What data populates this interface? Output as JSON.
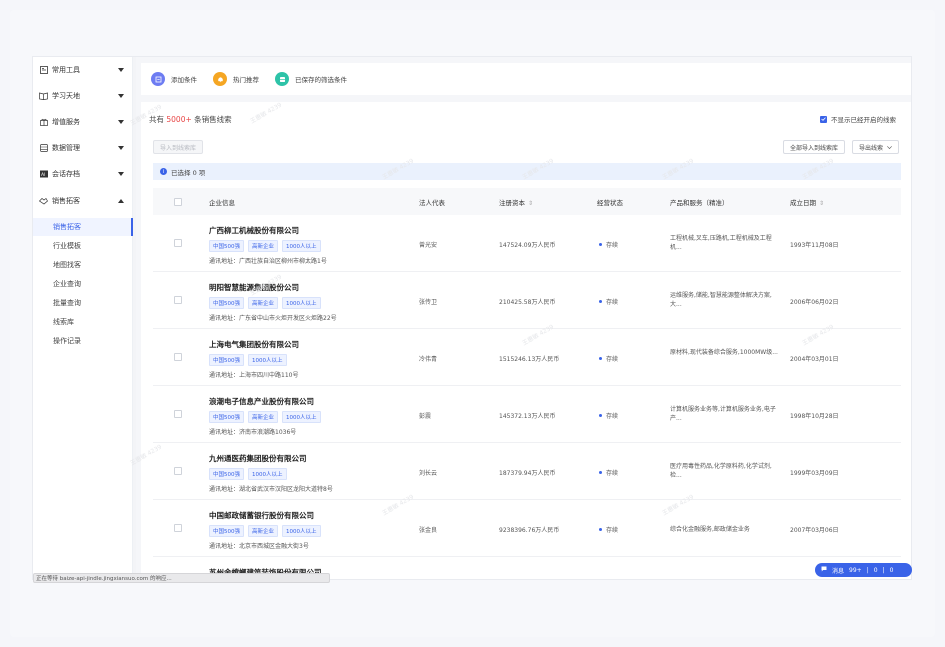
{
  "sidebar": {
    "groups": [
      {
        "label": "常用工具",
        "icon": "toolbox-icon",
        "expanded": false
      },
      {
        "label": "学习天地",
        "icon": "book-icon",
        "expanded": false
      },
      {
        "label": "增值服务",
        "icon": "gift-icon",
        "expanded": false
      },
      {
        "label": "数据管理",
        "icon": "database-icon",
        "expanded": false
      },
      {
        "label": "会话存档",
        "icon": "archive-icon",
        "expanded": false
      },
      {
        "label": "销售拓客",
        "icon": "handshake-icon",
        "expanded": true
      }
    ],
    "sub_items": [
      {
        "label": "销售拓客",
        "active": true
      },
      {
        "label": "行业模板",
        "active": false
      },
      {
        "label": "地图找客",
        "active": false
      },
      {
        "label": "企业查询",
        "active": false
      },
      {
        "label": "批量查询",
        "active": false
      },
      {
        "label": "线索库",
        "active": false
      },
      {
        "label": "操作记录",
        "active": false
      }
    ]
  },
  "toolbar": {
    "items": [
      {
        "label": "添加条件",
        "icon": "add-filter-icon",
        "color": "#6d7cf2"
      },
      {
        "label": "热门推荐",
        "icon": "bell-icon",
        "color": "#f5a623"
      },
      {
        "label": "已保存的筛选条件",
        "icon": "saved-icon",
        "color": "#2ec3a8"
      }
    ]
  },
  "summary": {
    "prefix": "共有",
    "count": "5000+",
    "suffix": "条销售线索",
    "hide_opened_label": "不显示已经开启的线索",
    "hide_opened_checked": true
  },
  "actions": {
    "import_to_library": "导入到线索库",
    "import_all": "全部导入到线索库",
    "export": "导出线索"
  },
  "selection": {
    "text": "已选择 0 项"
  },
  "table": {
    "headers": {
      "company": "企业信息",
      "legal_rep": "法人代表",
      "capital": "注册资本",
      "status": "经营状态",
      "products": "产品和服务（精准）",
      "founded": "成立日期"
    },
    "address_prefix": "通讯地址：",
    "rows": [
      {
        "company": "广西柳工机械股份有限公司",
        "tags": [
          "中国500强",
          "高新企业",
          "1000人以上"
        ],
        "address": "广西壮族自治区柳州市柳太路1号",
        "legal_rep": "曾光安",
        "capital": "147524.09万人民币",
        "status": "存续",
        "products": "工程机械,叉车,压路机,工程机械及工程机...",
        "founded": "1993年11月08日"
      },
      {
        "company": "明阳智慧能源集团股份公司",
        "tags": [
          "中国500强",
          "高新企业",
          "1000人以上"
        ],
        "address": "广东省中山市火炬开发区火炬路22号",
        "legal_rep": "张传卫",
        "capital": "210425.58万人民币",
        "status": "存续",
        "products": "运维服务,储能,智慧能源整体解决方案,大...",
        "founded": "2006年06月02日"
      },
      {
        "company": "上海电气集团股份有限公司",
        "tags": [
          "中国500强",
          "1000人以上"
        ],
        "address": "上海市四川中路110号",
        "legal_rep": "冷伟青",
        "capital": "1515246.13万人民币",
        "status": "存续",
        "products": "原材料,现代装备综合服务,1000MW级...",
        "founded": "2004年03月01日"
      },
      {
        "company": "浪潮电子信息产业股份有限公司",
        "tags": [
          "中国500强",
          "高新企业",
          "1000人以上"
        ],
        "address": "济南市浪潮路1036号",
        "legal_rep": "彭震",
        "capital": "145372.13万人民币",
        "status": "存续",
        "products": "计算机服务业务等,计算机服务业务,电子产...",
        "founded": "1998年10月28日"
      },
      {
        "company": "九州通医药集团股份有限公司",
        "tags": [
          "中国500强",
          "1000人以上"
        ],
        "address": "湖北省武汉市汉阳区龙阳大道特8号",
        "legal_rep": "刘长云",
        "capital": "187379.94万人民币",
        "status": "存续",
        "products": "医疗用毒性药品,化学原料药,化学试剂,检...",
        "founded": "1999年03月09日"
      },
      {
        "company": "中国邮政储蓄银行股份有限公司",
        "tags": [
          "中国500强",
          "高新企业",
          "1000人以上"
        ],
        "address": "北京市西城区金融大街3号",
        "legal_rep": "张金良",
        "capital": "9238396.76万人民币",
        "status": "存续",
        "products": "综合化金融服务,邮政储金业务",
        "founded": "2007年03月06日"
      },
      {
        "company": "苏州金螳螂建筑装饰股份有限公司",
        "tags": [],
        "address": "",
        "legal_rep": "",
        "capital": "",
        "status": "",
        "products": "",
        "founded": ""
      }
    ]
  },
  "status_bar": "正在等待 baize-api-jindle.jingxiansuo.com 的响应...",
  "message_pill": {
    "label": "消息",
    "count": "99+",
    "a": "0",
    "b": "0"
  },
  "watermark": "王惠敏 4239"
}
